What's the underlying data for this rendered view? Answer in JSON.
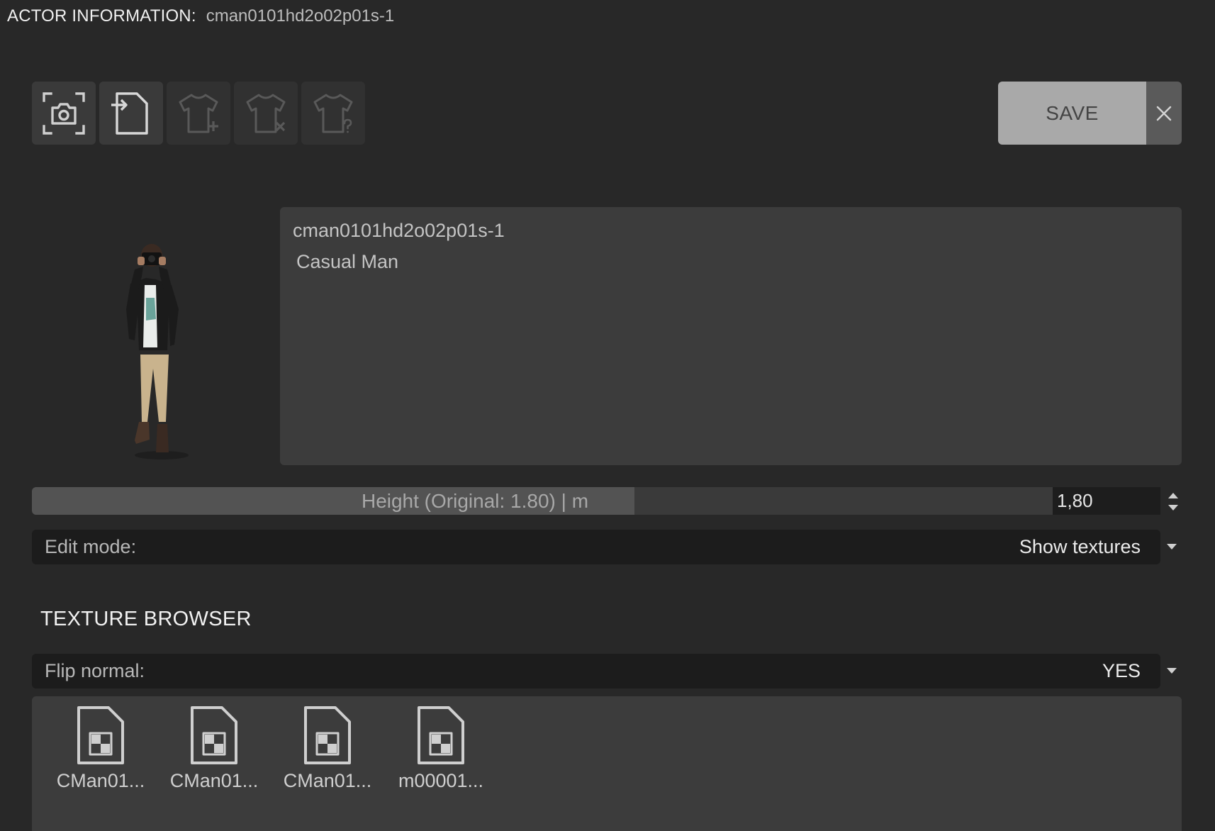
{
  "header": {
    "label": "ACTOR INFORMATION:",
    "actor_id": "cman0101hd2o02p01s-1"
  },
  "toolbar": {
    "buttons": [
      {
        "icon": "camera-screenshot-icon",
        "enabled": true
      },
      {
        "icon": "import-file-icon",
        "enabled": true
      },
      {
        "icon": "add-clothing-icon",
        "enabled": false
      },
      {
        "icon": "remove-clothing-icon",
        "enabled": false
      },
      {
        "icon": "clothing-help-icon",
        "enabled": false
      }
    ],
    "save_label": "SAVE",
    "close_icon": "close-icon"
  },
  "info": {
    "name": "cman0101hd2o02p01s-1",
    "description": "Casual Man"
  },
  "height": {
    "label": "Height (Original: 1.80) | m",
    "value": "1,80",
    "fill_fraction": 0.59
  },
  "edit_mode": {
    "label": "Edit mode:",
    "value": "Show textures"
  },
  "texture_browser": {
    "title": "TEXTURE BROWSER",
    "flip_normal": {
      "label": "Flip normal:",
      "value": "YES"
    },
    "files": [
      {
        "name": "CMan01...",
        "icon": "texture-file-icon"
      },
      {
        "name": "CMan01...",
        "icon": "texture-file-icon"
      },
      {
        "name": "CMan01...",
        "icon": "texture-file-icon"
      },
      {
        "name": "m00001...",
        "icon": "texture-file-icon"
      }
    ]
  },
  "colors": {
    "background": "#282828",
    "panel": "#3c3c3c",
    "field": "#1c1c1c",
    "save_button": "#a9a9a9"
  }
}
